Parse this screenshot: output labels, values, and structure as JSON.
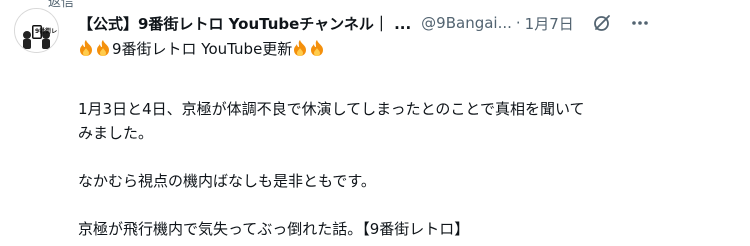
{
  "header": {
    "display_name": "【公式】9番街レトロ YouTubeチャンネル｜ ...",
    "handle": "@9Bangai...",
    "separator": "·",
    "date": "1月7日"
  },
  "icons": {
    "grok": "grok-icon",
    "more": "more-icon",
    "fire": "fire-emoji"
  },
  "top_strip_text": "返信",
  "tweet": {
    "line1_text": "9番街レトロ YouTube更新",
    "paragraph2": [
      "1月3日と4日、京極が体調不良で休演してしまったとのことで真相を聞いて",
      "みました。"
    ],
    "paragraph3": "なかむら視点の機内ばなしも是非ともです。",
    "paragraph4": "京極が飛行機内で気失ってぶっ倒れた話。【9番街レトロ】"
  },
  "avatar": {
    "brand_text": "9番街レトロ"
  },
  "colors": {
    "text": "#0f1419",
    "muted": "#536471",
    "fire_outer": "#f4900c",
    "fire_inner": "#ffcc4d"
  }
}
